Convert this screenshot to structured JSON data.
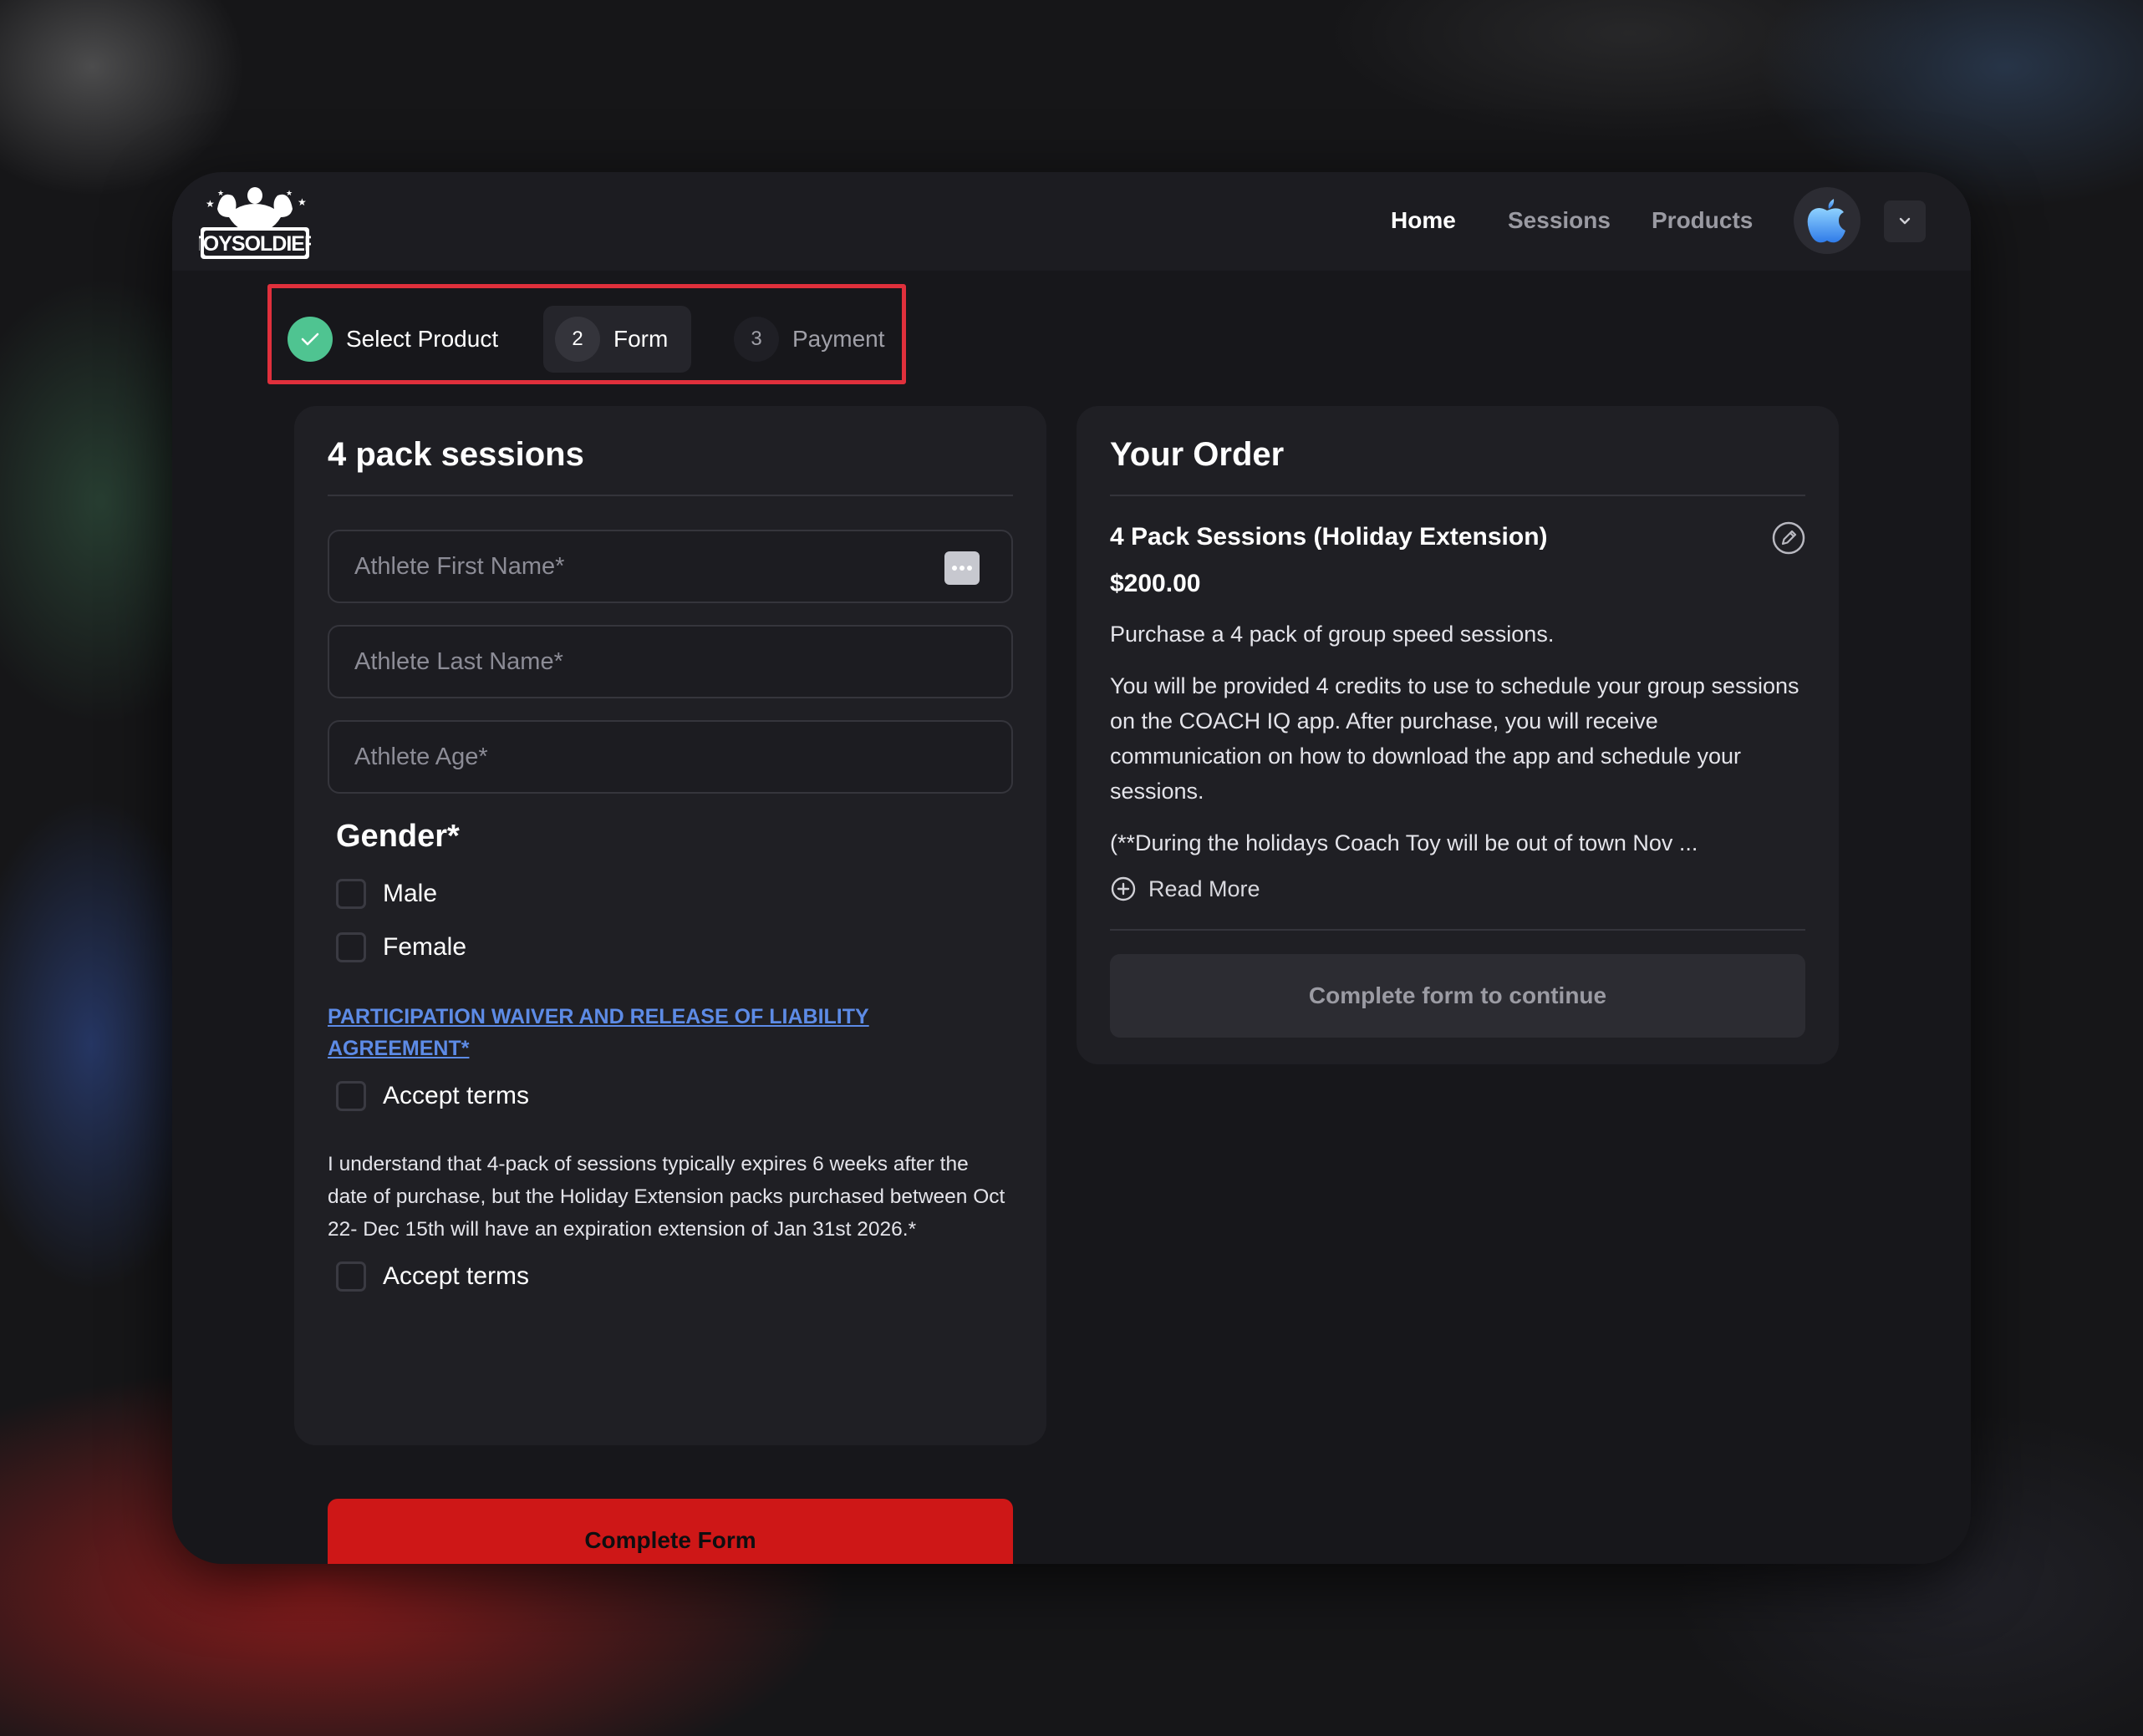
{
  "brand": {
    "logo_text": "TOYSOLDIER",
    "logo_icon": "flexing-strongman-logo"
  },
  "nav": {
    "items": [
      {
        "label": "Home",
        "active": true
      },
      {
        "label": "Sessions",
        "active": false
      },
      {
        "label": "Products",
        "active": false
      }
    ],
    "avatar_icon": "apple-avatar-icon",
    "menu_icon": "chevron-down-icon"
  },
  "stepper": {
    "steps": [
      {
        "number": "",
        "label": "Select Product",
        "status": "done"
      },
      {
        "number": "2",
        "label": "Form",
        "status": "active"
      },
      {
        "number": "3",
        "label": "Payment",
        "status": "todo"
      }
    ],
    "highlight_color": "#e0303c",
    "done_color": "#4fc491"
  },
  "form": {
    "title": "4 pack sessions",
    "fields": {
      "first_name": {
        "placeholder": "Athlete First Name*",
        "value": ""
      },
      "last_name": {
        "placeholder": "Athlete Last Name*",
        "value": ""
      },
      "age": {
        "placeholder": "Athlete Age*",
        "value": ""
      }
    },
    "gender": {
      "label": "Gender*",
      "options": [
        {
          "label": "Male",
          "checked": false
        },
        {
          "label": "Female",
          "checked": false
        }
      ]
    },
    "waiver": {
      "link_text": "PARTICIPATION WAIVER AND RELEASE OF LIABILITY AGREEMENT*",
      "accept_label": "Accept terms"
    },
    "expiration": {
      "text": "I understand that 4-pack of sessions typically expires 6 weeks after the date of purchase, but the Holiday Extension packs purchased between Oct 22- Dec 15th will have an expiration extension of Jan 31st 2026.*",
      "accept_label": "Accept terms"
    },
    "submit_label": "Complete Form",
    "submit_color": "#ce1717"
  },
  "order": {
    "title": "Your Order",
    "product_name": "4 Pack Sessions (Holiday Extension)",
    "price": "$200.00",
    "summary": "Purchase a 4 pack of group speed sessions.",
    "details": "You will be provided 4 credits to use to schedule your group sessions on the COACH IQ app. After purchase, you will receive communication on how to download the app and schedule your sessions.",
    "note": "(**During the holidays Coach Toy will be out of town Nov ...",
    "read_more_label": "Read More",
    "continue_label": "Complete form to continue"
  }
}
